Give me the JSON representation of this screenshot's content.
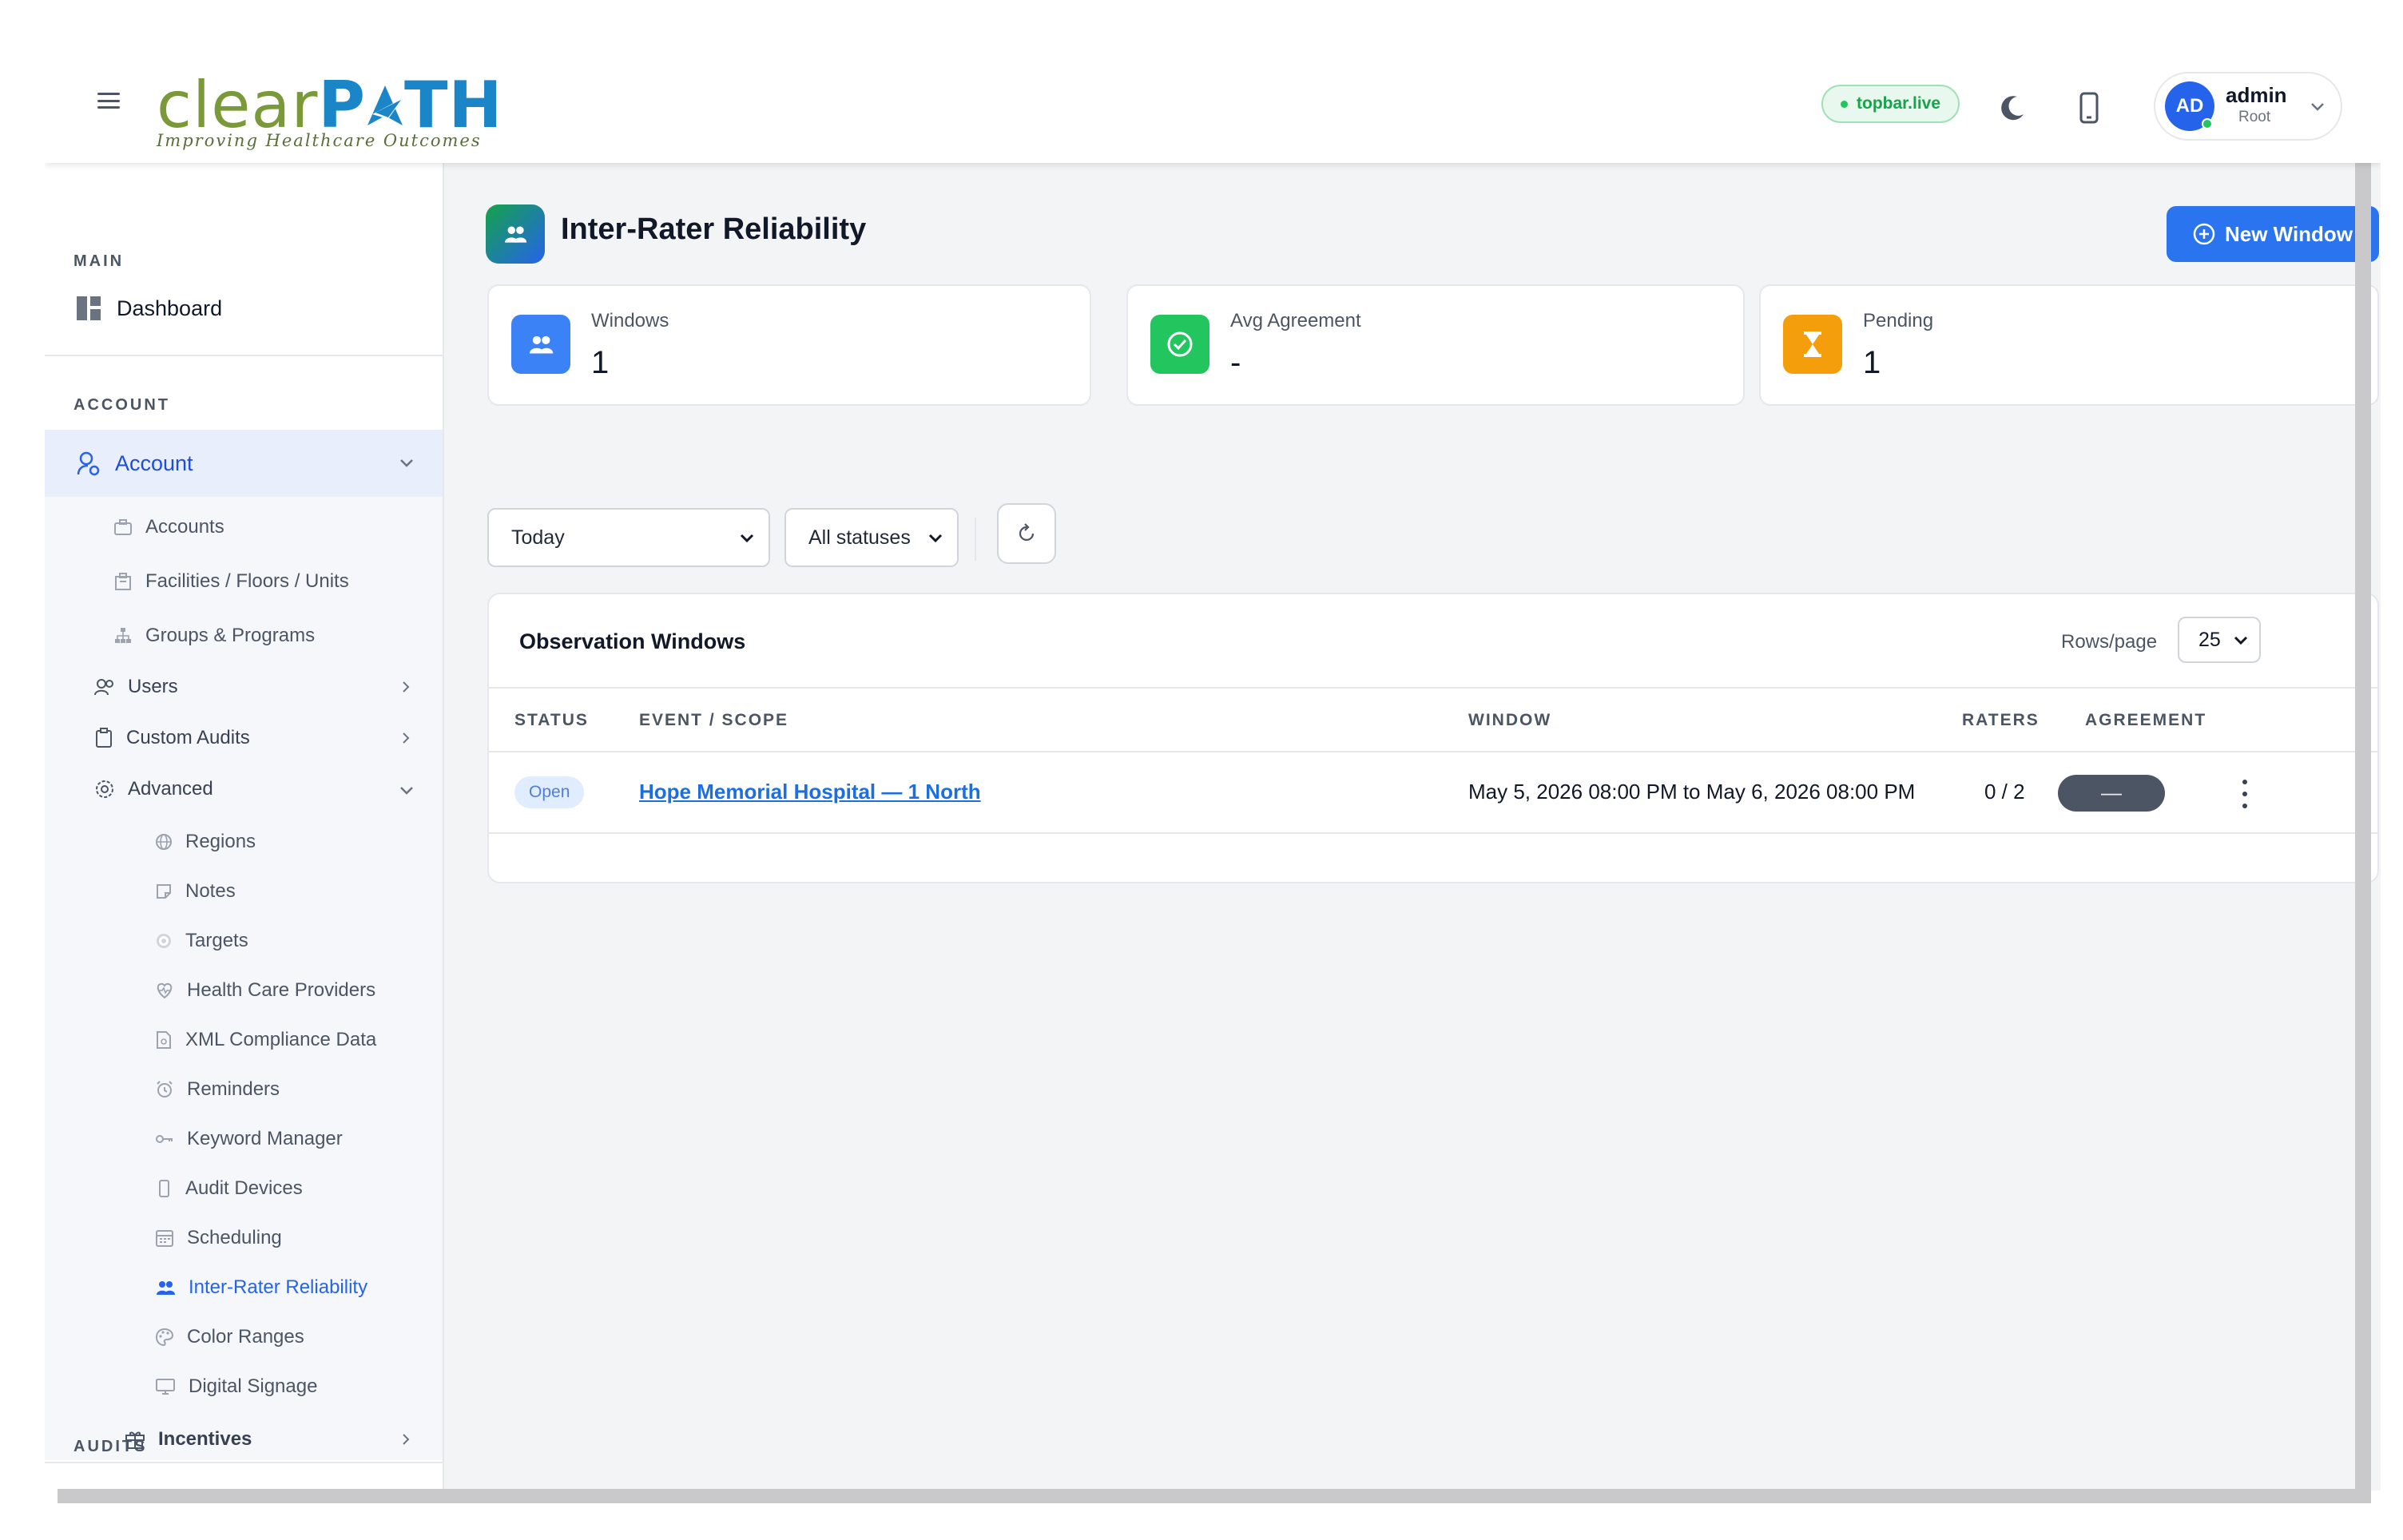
{
  "topbar": {
    "logo_part1": "clear",
    "logo_part2": "P",
    "logo_part3": "TH",
    "logo_tagline": "Improving Healthcare Outcomes",
    "live_badge": "topbar.live",
    "user": {
      "initials": "AD",
      "name": "admin",
      "role": "Root"
    }
  },
  "sidebar": {
    "main_heading": "MAIN",
    "dashboard": "Dashboard",
    "account_heading": "ACCOUNT",
    "account": "Account",
    "items": [
      {
        "label": "Accounts",
        "icon": "briefcase-icon"
      },
      {
        "label": "Facilities / Floors / Units",
        "icon": "building-icon"
      },
      {
        "label": "Groups & Programs",
        "icon": "sitemap-icon"
      }
    ],
    "users": "Users",
    "custom_audits": "Custom Audits",
    "advanced": "Advanced",
    "advanced_items": [
      {
        "label": "Regions",
        "icon": "globe-icon"
      },
      {
        "label": "Notes",
        "icon": "sticky-note-icon"
      },
      {
        "label": "Targets",
        "icon": "target-icon"
      },
      {
        "label": "Health Care Providers",
        "icon": "heartbeat-icon"
      },
      {
        "label": "XML Compliance Data",
        "icon": "file-code-icon"
      },
      {
        "label": "Reminders",
        "icon": "alarm-clock-icon"
      },
      {
        "label": "Keyword Manager",
        "icon": "key-icon"
      },
      {
        "label": "Audit Devices",
        "icon": "mobile-device-icon"
      },
      {
        "label": "Scheduling",
        "icon": "calendar-icon"
      },
      {
        "label": "Inter-Rater Reliability",
        "icon": "users-icon",
        "active": true
      },
      {
        "label": "Color Ranges",
        "icon": "palette-icon"
      },
      {
        "label": "Digital Signage",
        "icon": "monitor-icon"
      }
    ],
    "incentives": "Incentives",
    "audits_heading": "AUDITS"
  },
  "page": {
    "title": "Inter-Rater Reliability",
    "new_button": "New Window"
  },
  "stats": [
    {
      "title": "Windows",
      "value": "1",
      "color": "#3b82f6",
      "icon": "users-icon"
    },
    {
      "title": "Avg Agreement",
      "value": "-",
      "color": "#22c55e",
      "icon": "check-circle-icon"
    },
    {
      "title": "Pending",
      "value": "1",
      "color": "#f59e0b",
      "icon": "hourglass-icon"
    }
  ],
  "filters": {
    "range": "Today",
    "status": "All statuses"
  },
  "table": {
    "title": "Observation Windows",
    "rows_per_page_label": "Rows/page",
    "rows_per_page": "25",
    "headers": [
      "STATUS",
      "EVENT / SCOPE",
      "WINDOW",
      "RATERS",
      "AGREEMENT"
    ],
    "rows": [
      {
        "status": "Open",
        "event": "Hope Memorial Hospital — 1 North",
        "window": "May 5, 2026 08:00 PM to May 6, 2026 08:00 PM",
        "raters": "0 / 2",
        "agreement": "—"
      }
    ]
  },
  "colors": {
    "primary": "#2b74ef",
    "active_nav_bg": "#e8eefb",
    "logo_green": "#7a9a3a",
    "logo_blue": "#1a86c7"
  }
}
